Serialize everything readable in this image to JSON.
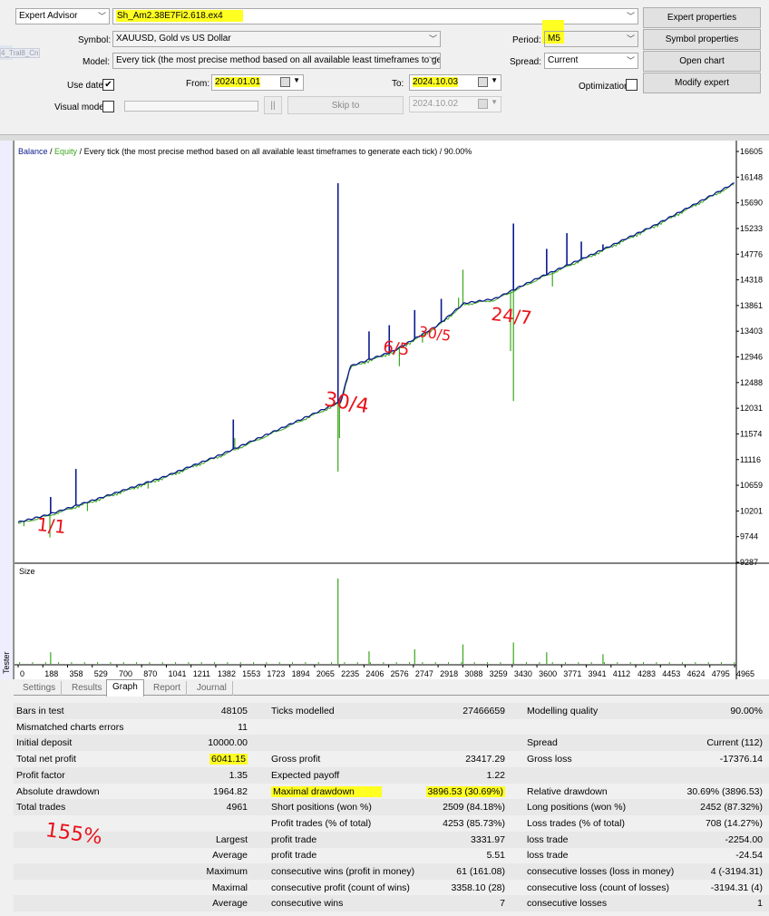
{
  "settings": {
    "expert_label": "Expert Advisor",
    "expert_file": "Sh_Am2.38E7Fi2.618.ex4",
    "symbol_label": "Symbol:",
    "symbol_value": "XAUUSD, Gold vs US Dollar",
    "model_label": "Model:",
    "model_value": "Every tick (the most precise method based on all available least timeframes to gener",
    "use_date_label": "Use date",
    "use_date_check": "✔",
    "from_label": "From:",
    "from_value": "2024.01.01",
    "to_label": "To:",
    "to_value": "2024.10.03",
    "visual_label": "Visual mode",
    "pause_label": "||",
    "skip_label": "Skip to",
    "skip_date": "2024.10.02",
    "period_label": "Period:",
    "period_value": "M5",
    "spread_label": "Spread:",
    "spread_value": "Current",
    "optimization_label": "Optimization",
    "side_tag": "4_Tral8_Cn"
  },
  "buttons": {
    "expert_properties": "Expert properties",
    "symbol_properties": "Symbol properties",
    "open_chart": "Open chart",
    "modify_expert": "Modify expert"
  },
  "chart_data": {
    "type": "line",
    "header_balance": "Balance",
    "header_sep1": " / ",
    "header_equity": "Equity",
    "header_rest": " / Every tick (the most precise method based on all available least timeframes to generate each tick) / 90.00%",
    "ylim": [
      9287,
      16605
    ],
    "y_ticks": [
      "16605",
      "16148",
      "15690",
      "15233",
      "14776",
      "14318",
      "13861",
      "13403",
      "12946",
      "12488",
      "12031",
      "11574",
      "11116",
      "10659",
      "10201",
      "9744",
      "9287"
    ],
    "x_ticks": [
      "0",
      "188",
      "358",
      "529",
      "700",
      "870",
      "1041",
      "1211",
      "1382",
      "1553",
      "1723",
      "1894",
      "2065",
      "2235",
      "2406",
      "2576",
      "2747",
      "2918",
      "3088",
      "3259",
      "3430",
      "3600",
      "3771",
      "3941",
      "4112",
      "4283",
      "4453",
      "4624",
      "4795",
      "4965"
    ],
    "xlim": [
      0,
      4961
    ],
    "size_label": "Size",
    "colors": {
      "balance": "#0a1a8c",
      "equity": "#3aa61c",
      "size_bars": "#3aa61c"
    },
    "balance_points": [
      [
        0,
        10000
      ],
      [
        200,
        10130
      ],
      [
        600,
        10460
      ],
      [
        1000,
        10800
      ],
      [
        1400,
        11200
      ],
      [
        1800,
        11650
      ],
      [
        2235,
        12150
      ],
      [
        2300,
        12780
      ],
      [
        2600,
        13050
      ],
      [
        2900,
        13500
      ],
      [
        3088,
        13900
      ],
      [
        3300,
        13980
      ],
      [
        3600,
        14350
      ],
      [
        4000,
        14800
      ],
      [
        4400,
        15280
      ],
      [
        4800,
        15820
      ],
      [
        4961,
        16041
      ]
    ],
    "balance_spikes": [
      [
        225,
        10450
      ],
      [
        400,
        10950
      ],
      [
        1490,
        11830
      ],
      [
        2215,
        16040
      ],
      [
        2430,
        13400
      ],
      [
        2570,
        13510
      ],
      [
        2746,
        13780
      ],
      [
        2930,
        13980
      ],
      [
        3430,
        15320
      ],
      [
        3660,
        14870
      ],
      [
        3800,
        15150
      ],
      [
        3900,
        15000
      ],
      [
        4050,
        14950
      ]
    ],
    "equity_drops": [
      [
        40,
        9930
      ],
      [
        220,
        9730
      ],
      [
        480,
        10200
      ],
      [
        900,
        10600
      ],
      [
        1500,
        11500
      ],
      [
        2215,
        10900
      ],
      [
        2225,
        11500
      ],
      [
        2640,
        12780
      ],
      [
        2800,
        13200
      ],
      [
        3050,
        14000
      ],
      [
        3080,
        14500
      ],
      [
        3410,
        13050
      ],
      [
        3430,
        12160
      ],
      [
        3700,
        14200
      ],
      [
        4200,
        15050
      ]
    ],
    "size_bars": [
      [
        225,
        0.12
      ],
      [
        2215,
        0.88
      ],
      [
        2430,
        0.13
      ],
      [
        2746,
        0.15
      ],
      [
        3080,
        0.2
      ],
      [
        3430,
        0.22
      ],
      [
        3660,
        0.12
      ],
      [
        4050,
        0.1
      ]
    ],
    "annotations": [
      "1/1",
      "30/4",
      "6/5",
      "30/5",
      "24/7",
      "155%"
    ]
  },
  "tabs": [
    "Settings",
    "Results",
    "Graph",
    "Report",
    "Journal"
  ],
  "results": [
    [
      "Bars in test",
      "48105",
      "Ticks modelled",
      "27466659",
      "Modelling quality",
      "90.00%"
    ],
    [
      "Mismatched charts errors",
      "11",
      "",
      "",
      "",
      ""
    ],
    [
      "Initial deposit",
      "10000.00",
      "",
      "",
      "Spread",
      "Current (112)"
    ],
    [
      "Total net profit",
      "6041.15",
      "Gross profit",
      "23417.29",
      "Gross loss",
      "-17376.14"
    ],
    [
      "Profit factor",
      "1.35",
      "Expected payoff",
      "1.22",
      "",
      ""
    ],
    [
      "Absolute drawdown",
      "1964.82",
      "Maximal drawdown",
      "3896.53 (30.69%)",
      "Relative drawdown",
      "30.69% (3896.53)"
    ],
    [
      "Total trades",
      "4961",
      "Short positions (won %)",
      "2509 (84.18%)",
      "Long positions (won %)",
      "2452 (87.32%)"
    ],
    [
      "",
      "",
      "Profit trades (% of total)",
      "4253 (85.73%)",
      "Loss trades (% of total)",
      "708 (14.27%)"
    ],
    [
      "",
      "Largest",
      "profit trade",
      "3331.97",
      "loss trade",
      "-2254.00"
    ],
    [
      "",
      "Average",
      "profit trade",
      "5.51",
      "loss trade",
      "-24.54"
    ],
    [
      "",
      "Maximum",
      "consecutive wins (profit in money)",
      "61 (161.08)",
      "consecutive losses (loss in money)",
      "4 (-3194.31)"
    ],
    [
      "",
      "Maximal",
      "consecutive profit (count of wins)",
      "3358.10 (28)",
      "consecutive loss (count of losses)",
      "-3194.31 (4)"
    ],
    [
      "",
      "Average",
      "consecutive wins",
      "7",
      "consecutive losses",
      "1"
    ]
  ],
  "tester_label": "Tester"
}
